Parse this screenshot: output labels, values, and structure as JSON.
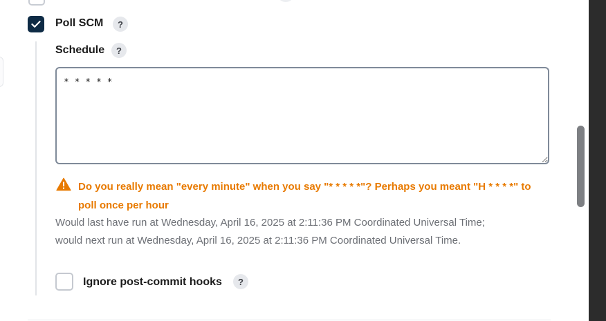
{
  "poll_scm": {
    "label": "Poll SCM",
    "checked": true,
    "help_glyph": "?"
  },
  "schedule": {
    "label": "Schedule",
    "help_glyph": "?",
    "value": "* * * * *"
  },
  "warning": {
    "icon": "warning-triangle-icon",
    "text": "Do you really mean \"every minute\" when you say \"* * * * *\"? Perhaps you meant \"H * * * *\" to poll once per hour"
  },
  "run_info": {
    "last_run": "Would last have run at Wednesday, April 16, 2025 at 2:11:36 PM Coordinated Universal Time;",
    "next_run": "would next run at Wednesday, April 16, 2025 at 2:11:36 PM Coordinated Universal Time."
  },
  "ignore_hooks": {
    "label": "Ignore post-commit hooks",
    "checked": false,
    "help_glyph": "?"
  },
  "colors": {
    "checkbox_checked": "#0e2b45",
    "warning": "#e87a00",
    "info_text": "#6c6f75"
  }
}
